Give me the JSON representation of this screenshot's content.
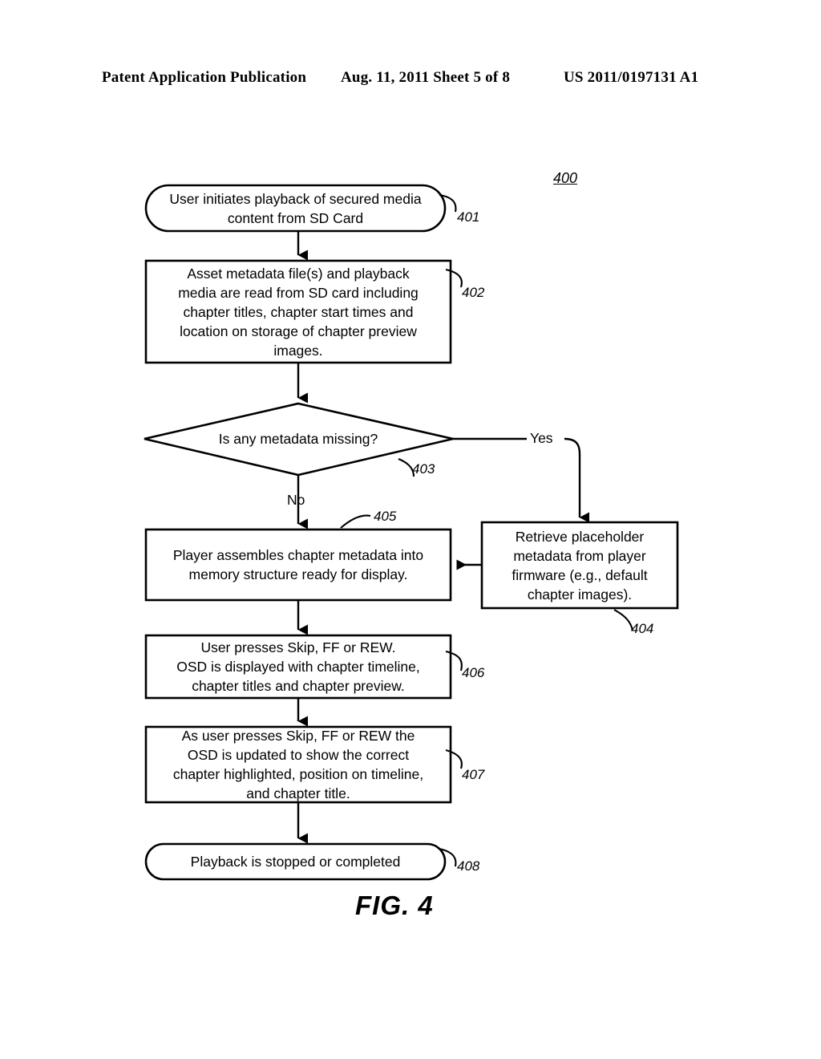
{
  "header": {
    "left": "Patent Application Publication",
    "middle": "Aug. 11, 2011  Sheet 5 of 8",
    "right": "US 2011/0197131 A1"
  },
  "figure": {
    "caption": "FIG. 4",
    "diagram_ref": "400",
    "line_color": "#000000",
    "fill_color": "#ffffff"
  },
  "flowchart": {
    "nodes": [
      {
        "id": "401",
        "shape": "terminator",
        "ref": "401",
        "text": "User initiates playback of secured media\ncontent from SD Card"
      },
      {
        "id": "402",
        "shape": "process",
        "ref": "402",
        "text": "Asset metadata file(s) and playback\nmedia are read from SD card including\nchapter titles, chapter start times and\nlocation on storage of chapter preview\nimages."
      },
      {
        "id": "403",
        "shape": "decision",
        "ref": "403",
        "text": "Is any metadata missing?"
      },
      {
        "id": "404",
        "shape": "process",
        "ref": "404",
        "text": "Retrieve placeholder\nmetadata from player\nfirmware (e.g., default\nchapter images)."
      },
      {
        "id": "405",
        "shape": "process",
        "ref": "405",
        "text": "Player assembles chapter metadata into\nmemory structure ready for display."
      },
      {
        "id": "406",
        "shape": "process",
        "ref": "406",
        "text": "User presses Skip, FF or REW.\nOSD is displayed with chapter timeline,\nchapter titles and chapter preview."
      },
      {
        "id": "407",
        "shape": "process",
        "ref": "407",
        "text": "As user presses Skip, FF or REW the\nOSD is updated to show the correct\nchapter highlighted, position on timeline,\nand chapter title."
      },
      {
        "id": "408",
        "shape": "terminator",
        "ref": "408",
        "text": "Playback is stopped or completed"
      }
    ],
    "branch_labels": {
      "yes": "Yes",
      "no": "No"
    }
  }
}
